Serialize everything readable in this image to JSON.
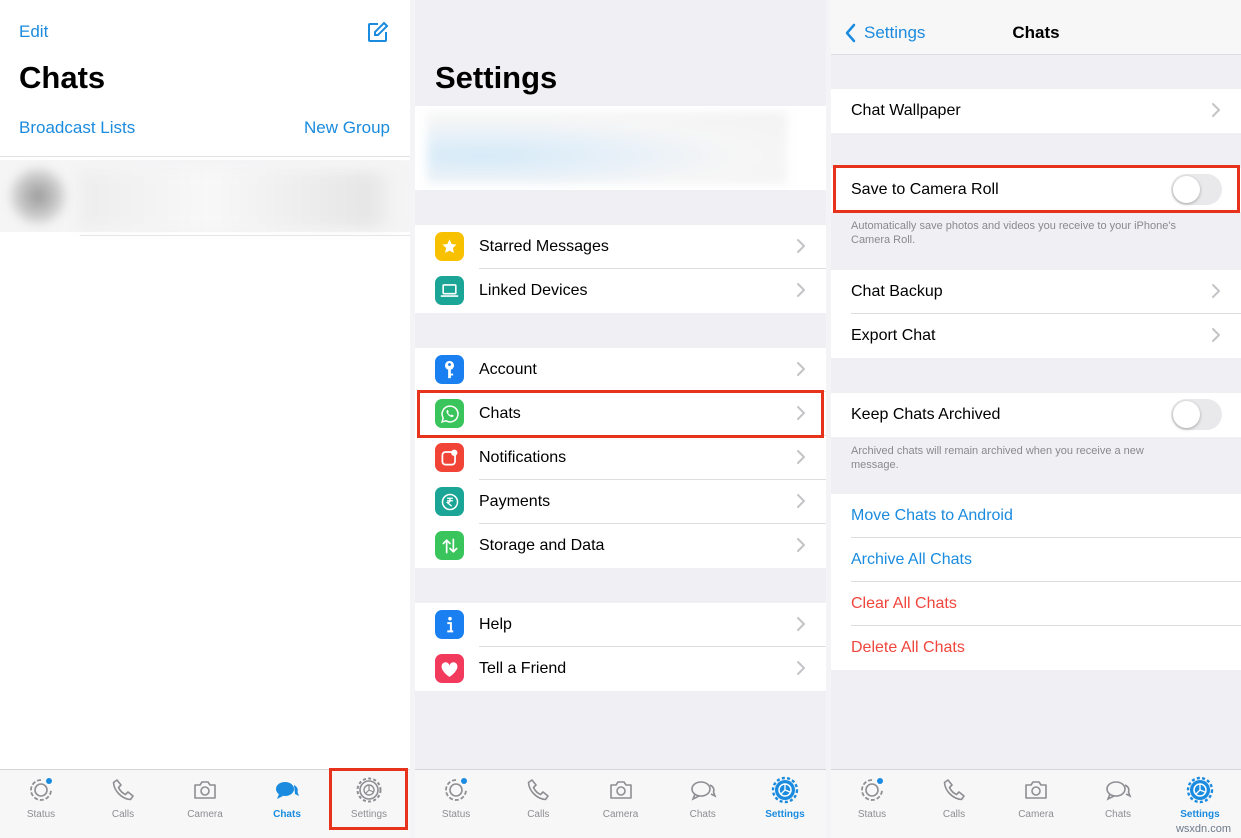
{
  "panel1": {
    "edit_label": "Edit",
    "title": "Chats",
    "broadcast_label": "Broadcast Lists",
    "new_group_label": "New Group"
  },
  "panel2": {
    "title": "Settings",
    "groups": [
      [
        {
          "label": "Starred Messages",
          "icon": "star-icon",
          "color": "#f7c100"
        },
        {
          "label": "Linked Devices",
          "icon": "laptop-icon",
          "color": "#1aa597"
        }
      ],
      [
        {
          "label": "Account",
          "icon": "key-icon",
          "color": "#1a7ff0"
        },
        {
          "label": "Chats",
          "icon": "whatsapp-icon",
          "color": "#3ac45c"
        },
        {
          "label": "Notifications",
          "icon": "notification-icon",
          "color": "#f14437"
        },
        {
          "label": "Payments",
          "icon": "rupee-icon",
          "color": "#1aa597"
        },
        {
          "label": "Storage and Data",
          "icon": "arrows-updown-icon",
          "color": "#3ac45c"
        }
      ],
      [
        {
          "label": "Help",
          "icon": "info-icon",
          "color": "#1a7ff0"
        },
        {
          "label": "Tell a Friend",
          "icon": "heart-icon",
          "color": "#f23a5c"
        }
      ]
    ]
  },
  "panel3": {
    "back_label": "Settings",
    "title": "Chats",
    "chat_wallpaper": "Chat Wallpaper",
    "save_camera_roll": "Save to Camera Roll",
    "save_note": "Automatically save photos and videos you receive to your iPhone's Camera Roll.",
    "chat_backup": "Chat Backup",
    "export_chat": "Export Chat",
    "keep_archived": "Keep Chats Archived",
    "archived_note": "Archived chats will remain archived when you receive a new message.",
    "move_android": "Move Chats to Android",
    "archive_all": "Archive All Chats",
    "clear_all": "Clear All Chats",
    "delete_all": "Delete All Chats",
    "save_camera_roll_on": false,
    "keep_archived_on": false
  },
  "tabs": [
    "Status",
    "Calls",
    "Camera",
    "Chats",
    "Settings"
  ],
  "active_tab": {
    "panel1": "Chats",
    "panel2": "Settings",
    "panel3": "Settings"
  },
  "colors": {
    "accent": "#1a8bde",
    "destructive": "#f0463c",
    "highlight": "#e8331c"
  },
  "watermark": "wsxdn.com"
}
